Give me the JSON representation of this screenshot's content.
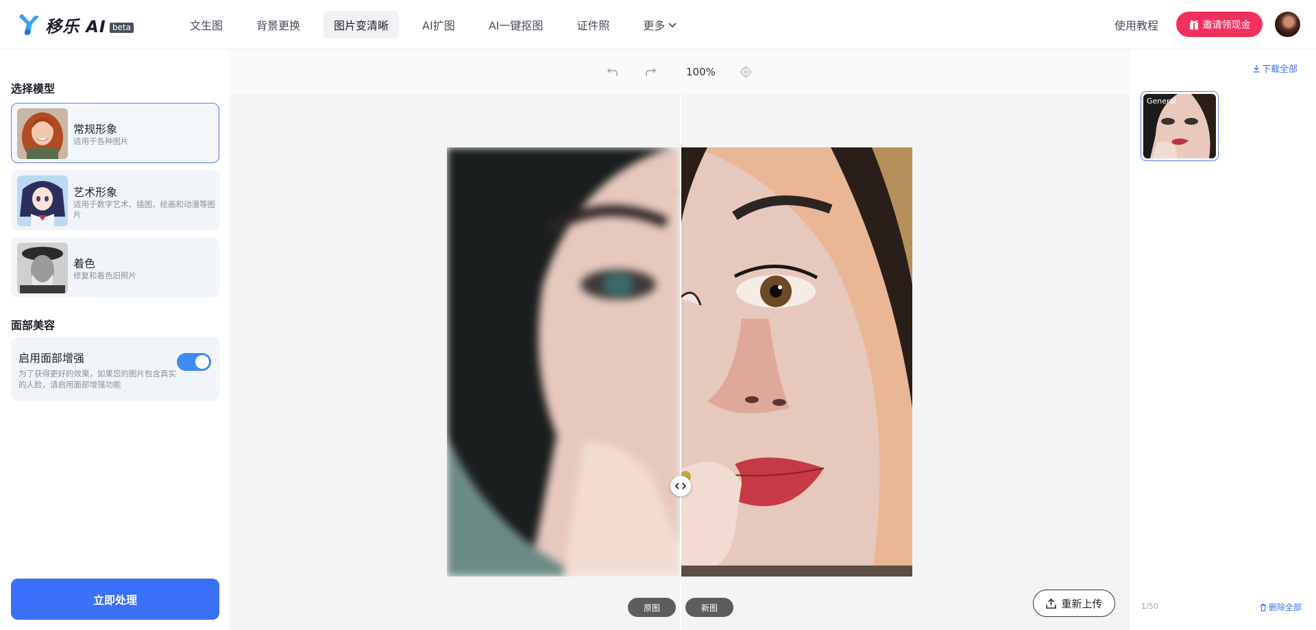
{
  "app": {
    "name": "移乐 AI",
    "badge": "beta"
  },
  "nav": {
    "items": [
      {
        "label": "文生图",
        "active": false
      },
      {
        "label": "背景更换",
        "active": false
      },
      {
        "label": "图片变清晰",
        "active": true
      },
      {
        "label": "AI扩图",
        "active": false
      },
      {
        "label": "AI一键抠图",
        "active": false
      },
      {
        "label": "证件照",
        "active": false
      },
      {
        "label": "更多",
        "active": false
      }
    ],
    "help": "使用教程",
    "invite": "邀请领现金"
  },
  "left": {
    "model_title": "选择模型",
    "models": [
      {
        "name": "常规形象",
        "desc": "适用于各种图片",
        "selected": true
      },
      {
        "name": "艺术形象",
        "desc": "适用于数字艺术、插图、绘画和动漫等图片",
        "selected": false
      },
      {
        "name": "着色",
        "desc": "修复和着色旧照片",
        "selected": false
      }
    ],
    "face_title": "面部美容",
    "face": {
      "title": "启用面部增强",
      "desc": "为了获得更好的效果，如果您的图片包含真实的人脸，请启用面部增强功能",
      "enabled": true
    },
    "process": "立即处理"
  },
  "center": {
    "zoom": "100%",
    "tag_original": "原图",
    "tag_new": "新图",
    "reupload": "重新上传"
  },
  "right": {
    "download_all": "下载全部",
    "result_label": "General",
    "counter": "1/50",
    "delete_all": "删除全部"
  },
  "colors": {
    "accent": "#3a6ff8",
    "invite": "#f2305e",
    "toggle": "#3c8cf3"
  }
}
